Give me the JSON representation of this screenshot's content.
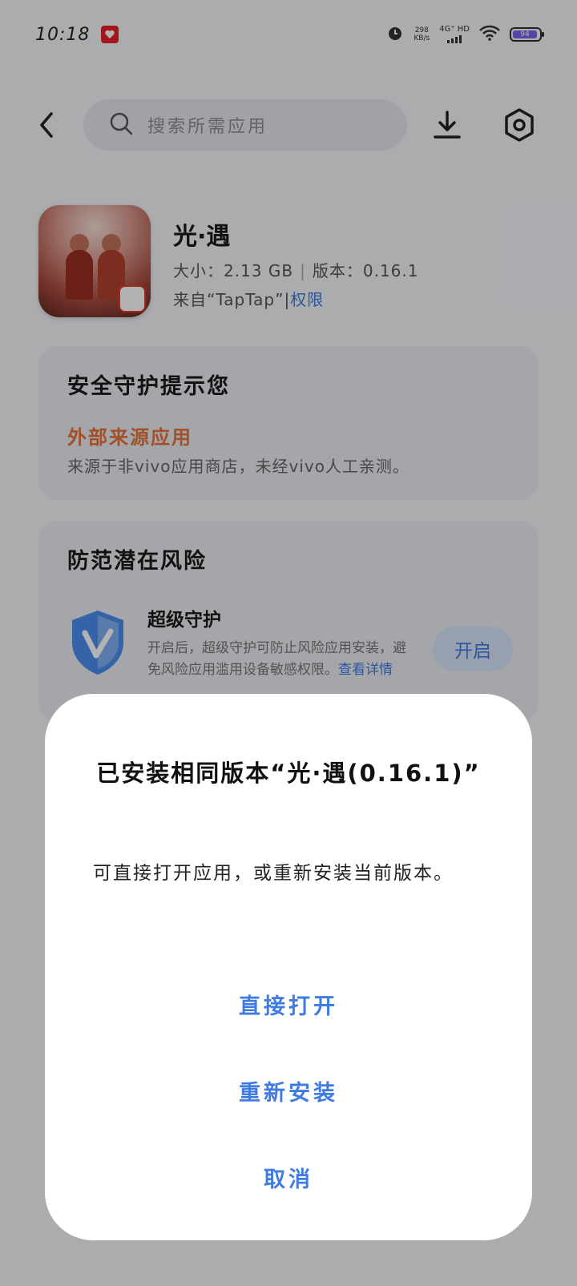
{
  "status_bar": {
    "time": "10:18",
    "net_speed_value": "298",
    "net_speed_unit": "KB/s",
    "network_type": "4G⁺ HD",
    "battery_level": "94"
  },
  "header": {
    "search_placeholder": "搜索所需应用"
  },
  "app": {
    "name": "光·遇",
    "size_label": "大小：2.13 GB",
    "version_label": "版本：0.16.1",
    "source_label": "来自“TapTap”",
    "permission_label": "权限"
  },
  "security_card": {
    "title": "安全守护提示您",
    "warning_title": "外部来源应用",
    "warning_desc": "来源于非vivo应用商店，未经vivo人工亲测。"
  },
  "risk_card": {
    "title": "防范潜在风险",
    "guard_title": "超级守护",
    "guard_desc": "开启后，超级守护可防止风险应用安装，避免风险应用滥用设备敏感权限。",
    "guard_link": "查看详情",
    "enable_label": "开启"
  },
  "dialog": {
    "title": "已安装相同版本“光·遇(0.16.1)”",
    "message": "可直接打开应用，或重新安装当前版本。",
    "open_label": "直接打开",
    "reinstall_label": "重新安装",
    "cancel_label": "取消"
  },
  "colors": {
    "accent": "#3f7be0",
    "warning": "#e8733b",
    "scrim": "#000000"
  }
}
